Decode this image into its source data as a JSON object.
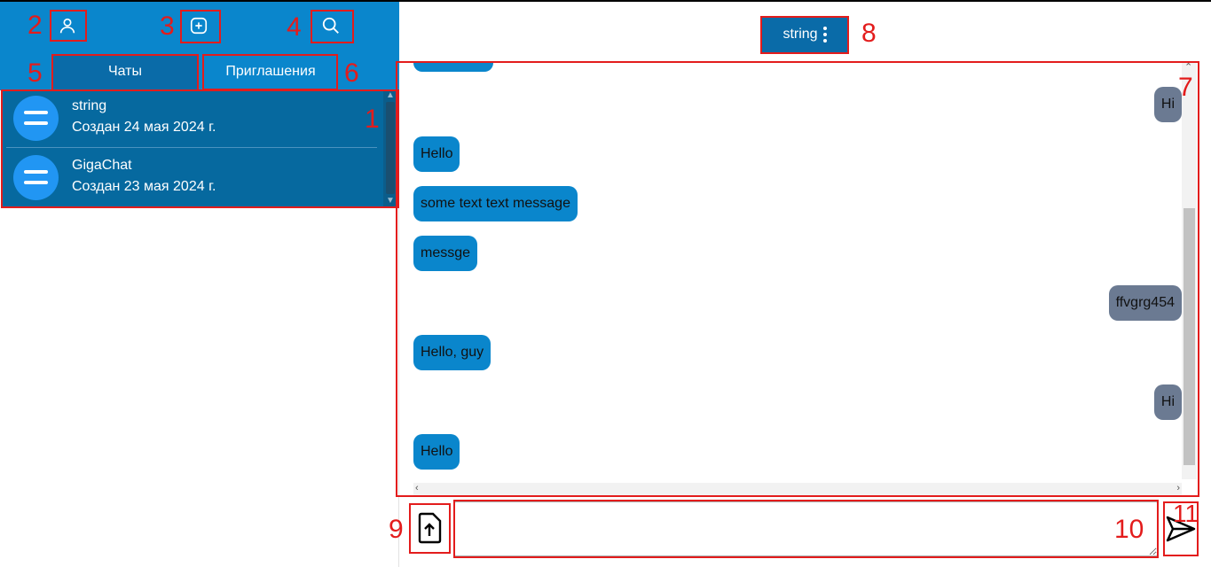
{
  "sidebar": {
    "tabs": [
      {
        "label": "Чаты",
        "active": true
      },
      {
        "label": "Приглашения",
        "active": false
      }
    ],
    "chats": [
      {
        "name": "string",
        "date": "Создан 24 мая 2024 г."
      },
      {
        "name": "GigaChat",
        "date": "Создан 23 мая 2024 г."
      }
    ],
    "icons": {
      "profile": "user-icon",
      "create": "plus-square-icon",
      "search": "search-icon"
    }
  },
  "header": {
    "chat_name": "string"
  },
  "messages": [
    {
      "text": "Hi",
      "side": "out"
    },
    {
      "text": "Hello",
      "side": "in"
    },
    {
      "text": "some text text message",
      "side": "in"
    },
    {
      "text": "messge",
      "side": "in"
    },
    {
      "text": "ffvgrg454",
      "side": "out"
    },
    {
      "text": "Hello, guy",
      "side": "in"
    },
    {
      "text": "Hi",
      "side": "out"
    },
    {
      "text": "Hello",
      "side": "in"
    }
  ],
  "composer": {
    "placeholder": "",
    "value": ""
  },
  "annotations": [
    "1",
    "2",
    "3",
    "4",
    "5",
    "6",
    "7",
    "8",
    "9",
    "10",
    "11"
  ],
  "colors": {
    "accent": "#0a86cc",
    "accent_dark": "#0a6ba8",
    "outgoing": "#6b7a92",
    "annotation": "#e31c1c"
  }
}
